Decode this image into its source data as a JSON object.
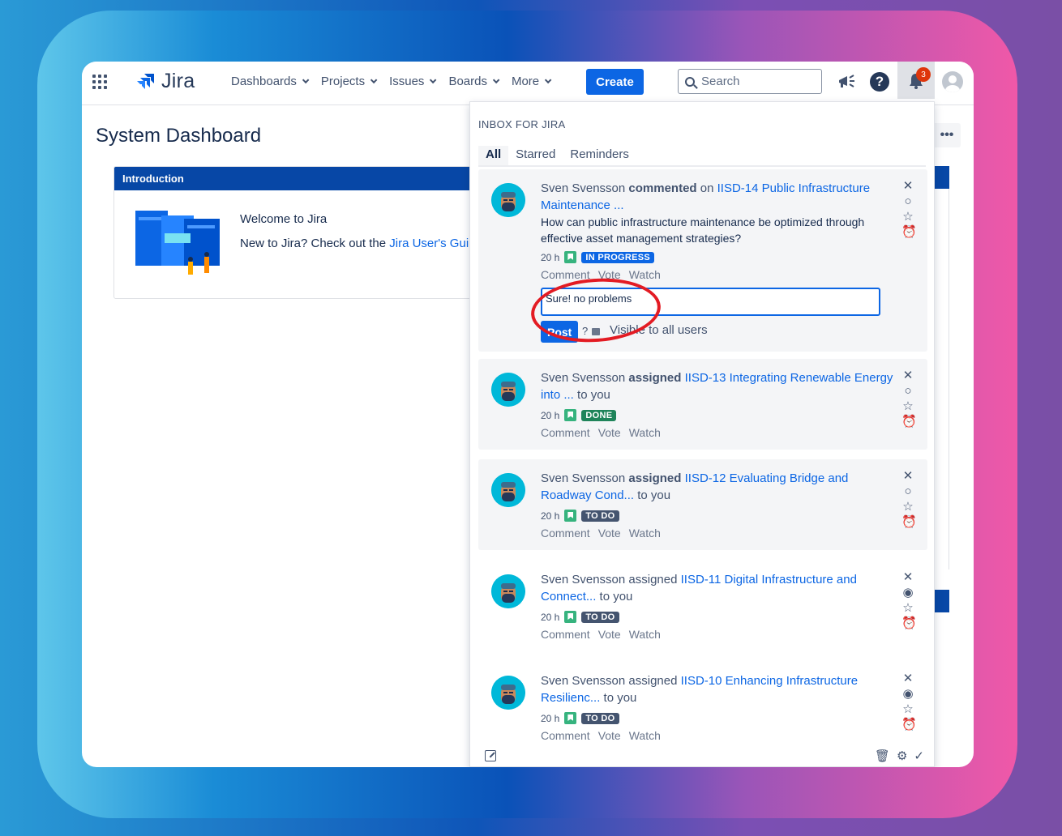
{
  "nav": {
    "app_name": "Jira",
    "menu": [
      {
        "label": "Dashboards"
      },
      {
        "label": "Projects"
      },
      {
        "label": "Issues"
      },
      {
        "label": "Boards"
      },
      {
        "label": "More"
      }
    ],
    "create_label": "Create",
    "search_placeholder": "Search",
    "help_label": "?",
    "notification_count": "3"
  },
  "dashboard": {
    "title": "System Dashboard",
    "more_label": "•••",
    "gadget": {
      "title": "Introduction",
      "welcome": "Welcome to Jira",
      "new_to_prefix": "New to Jira? Check out the ",
      "new_to_link": "Jira User's Gui"
    }
  },
  "inbox": {
    "title": "INBOX FOR JIRA",
    "tabs": [
      {
        "label": "All",
        "active": true
      },
      {
        "label": "Starred"
      },
      {
        "label": "Reminders"
      }
    ],
    "notifications": [
      {
        "actor": "Sven Svensson",
        "verb": "commented",
        "connector": " on ",
        "issue": "IISD-14 Public Infrastructure Maintenance ...",
        "suffix": "",
        "body": "How can public infrastructure maintenance be optimized through effective asset management strategies?",
        "time": "20 h",
        "status": "IN PROGRESS",
        "actions": [
          "Comment",
          "Vote",
          "Watch"
        ],
        "reply_value": "Sure! no problems",
        "post_label": "Post",
        "help_mark": "?",
        "visibility": "Visible to all users"
      },
      {
        "actor": "Sven Svensson",
        "verb": "assigned",
        "connector": " ",
        "issue": "IISD-13 Integrating Renewable Energy into ...",
        "suffix": " to you",
        "time": "20 h",
        "status": "DONE",
        "actions": [
          "Comment",
          "Vote",
          "Watch"
        ]
      },
      {
        "actor": "Sven Svensson",
        "verb": "assigned",
        "connector": " ",
        "issue": "IISD-12 Evaluating Bridge and Roadway Cond...",
        "suffix": " to you",
        "time": "20 h",
        "status": "TO DO",
        "actions": [
          "Comment",
          "Vote",
          "Watch"
        ]
      },
      {
        "actor": "Sven Svensson",
        "verb": "assigned",
        "connector": " ",
        "issue": "IISD-11 Digital Infrastructure and Connect...",
        "suffix": " to you",
        "time": "20 h",
        "status": "TO DO",
        "actions": [
          "Comment",
          "Vote",
          "Watch"
        ]
      },
      {
        "actor": "Sven Svensson",
        "verb": "assigned",
        "connector": " ",
        "issue": "IISD-10 Enhancing Infrastructure Resilienc...",
        "suffix": " to you",
        "time": "20 h",
        "status": "TO DO",
        "actions": [
          "Comment",
          "Vote",
          "Watch"
        ]
      }
    ]
  },
  "colors": {
    "primary": "#0c66e4",
    "done": "#1f845a",
    "todo": "#44546f",
    "annotation": "#e31b23"
  }
}
